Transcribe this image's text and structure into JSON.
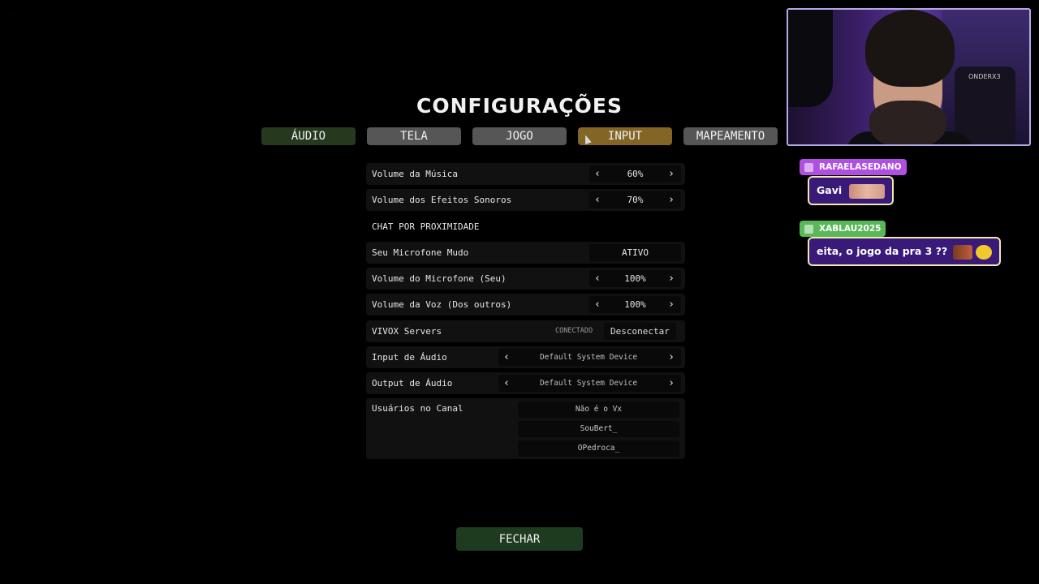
{
  "title": "CONFIGURAÇÕES",
  "tabs": {
    "audio": "ÁUDIO",
    "tela": "TELA",
    "jogo": "JOGO",
    "input": "INPUT",
    "mapeamento": "MAPEAMENTO"
  },
  "settings": {
    "music_volume": {
      "label": "Volume da Música",
      "value": "60%"
    },
    "sfx_volume": {
      "label": "Volume dos Efeitos Sonoros",
      "value": "70%"
    },
    "proximity_header": "CHAT POR PROXIMIDADE",
    "mic_mute": {
      "label": "Seu Microfone Mudo",
      "value": "ATIVO"
    },
    "mic_volume": {
      "label": "Volume do Microfone (Seu)",
      "value": "100%"
    },
    "voice_volume": {
      "label": "Volume da Voz (Dos outros)",
      "value": "100%"
    },
    "vivox": {
      "label": "VIVOX Servers",
      "status": "CONECTADO",
      "button": "Desconectar"
    },
    "audio_input": {
      "label": "Input de Áudio",
      "value": "Default System Device"
    },
    "audio_output": {
      "label": "Output de Áudio",
      "value": "Default System Device"
    },
    "channel_users": {
      "label": "Usuários no Canal",
      "users": [
        "Não é o Vx",
        "SouBert_",
        "OPedroca_"
      ]
    }
  },
  "close_button": "FECHAR",
  "arrows": {
    "left": "‹",
    "right": "›"
  },
  "webcam": {
    "chair_text": "ONDERX3"
  },
  "chat": [
    {
      "username": "RAFAELASEDANO",
      "message": "Gavi",
      "name_color": "#b050e0"
    },
    {
      "username": "XABLAU2025",
      "message": "eita, o jogo da pra 3 ??",
      "name_color": "#58b858"
    }
  ],
  "colors": {
    "tab_active": "#836526",
    "tab_audio": "#26391f",
    "tab_default": "#565656",
    "close_button": "#1e3b1f",
    "chat_bubble": "#3a1a78"
  }
}
